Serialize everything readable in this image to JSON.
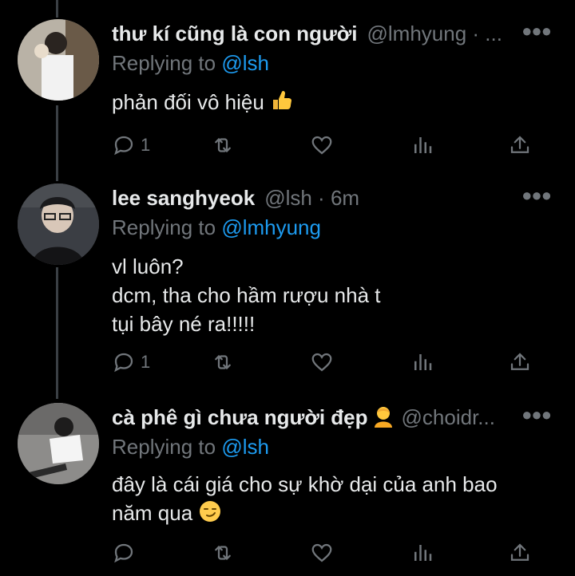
{
  "tweets": [
    {
      "name": "thư kí cũng là con người",
      "handle": "@lmhyung · ...",
      "replying_prefix": "Replying to",
      "replying_to": "@lsh",
      "lines": [
        "phản đối vô hiệu"
      ],
      "reply_count": "1",
      "avatar_desc": "avatar"
    },
    {
      "name": "lee sanghyeok",
      "handle": "@lsh · 6m",
      "replying_prefix": "Replying to",
      "replying_to": "@lmhyung",
      "lines": [
        "vl luôn?",
        "dcm, tha cho hầm rượu nhà t",
        "tụi bây né ra!!!!!"
      ],
      "reply_count": "1"
    },
    {
      "name": "cà phê gì chưa người đẹp",
      "handle": "@choidr...",
      "replying_prefix": "Replying to",
      "replying_to": "@lsh",
      "lines": [
        "đây là cái giá cho sự khờ dại của anh bao",
        "năm qua"
      ],
      "reply_count": ""
    }
  ],
  "icons": {
    "reply": "reply-icon",
    "retweet": "retweet-icon",
    "like": "heart-icon",
    "analytics": "analytics-icon",
    "share": "share-icon",
    "more": "more-icon"
  },
  "colors": {
    "background": "#000000",
    "text": "#e7e9ea",
    "muted": "#71767b",
    "link": "#1d9bf0"
  }
}
